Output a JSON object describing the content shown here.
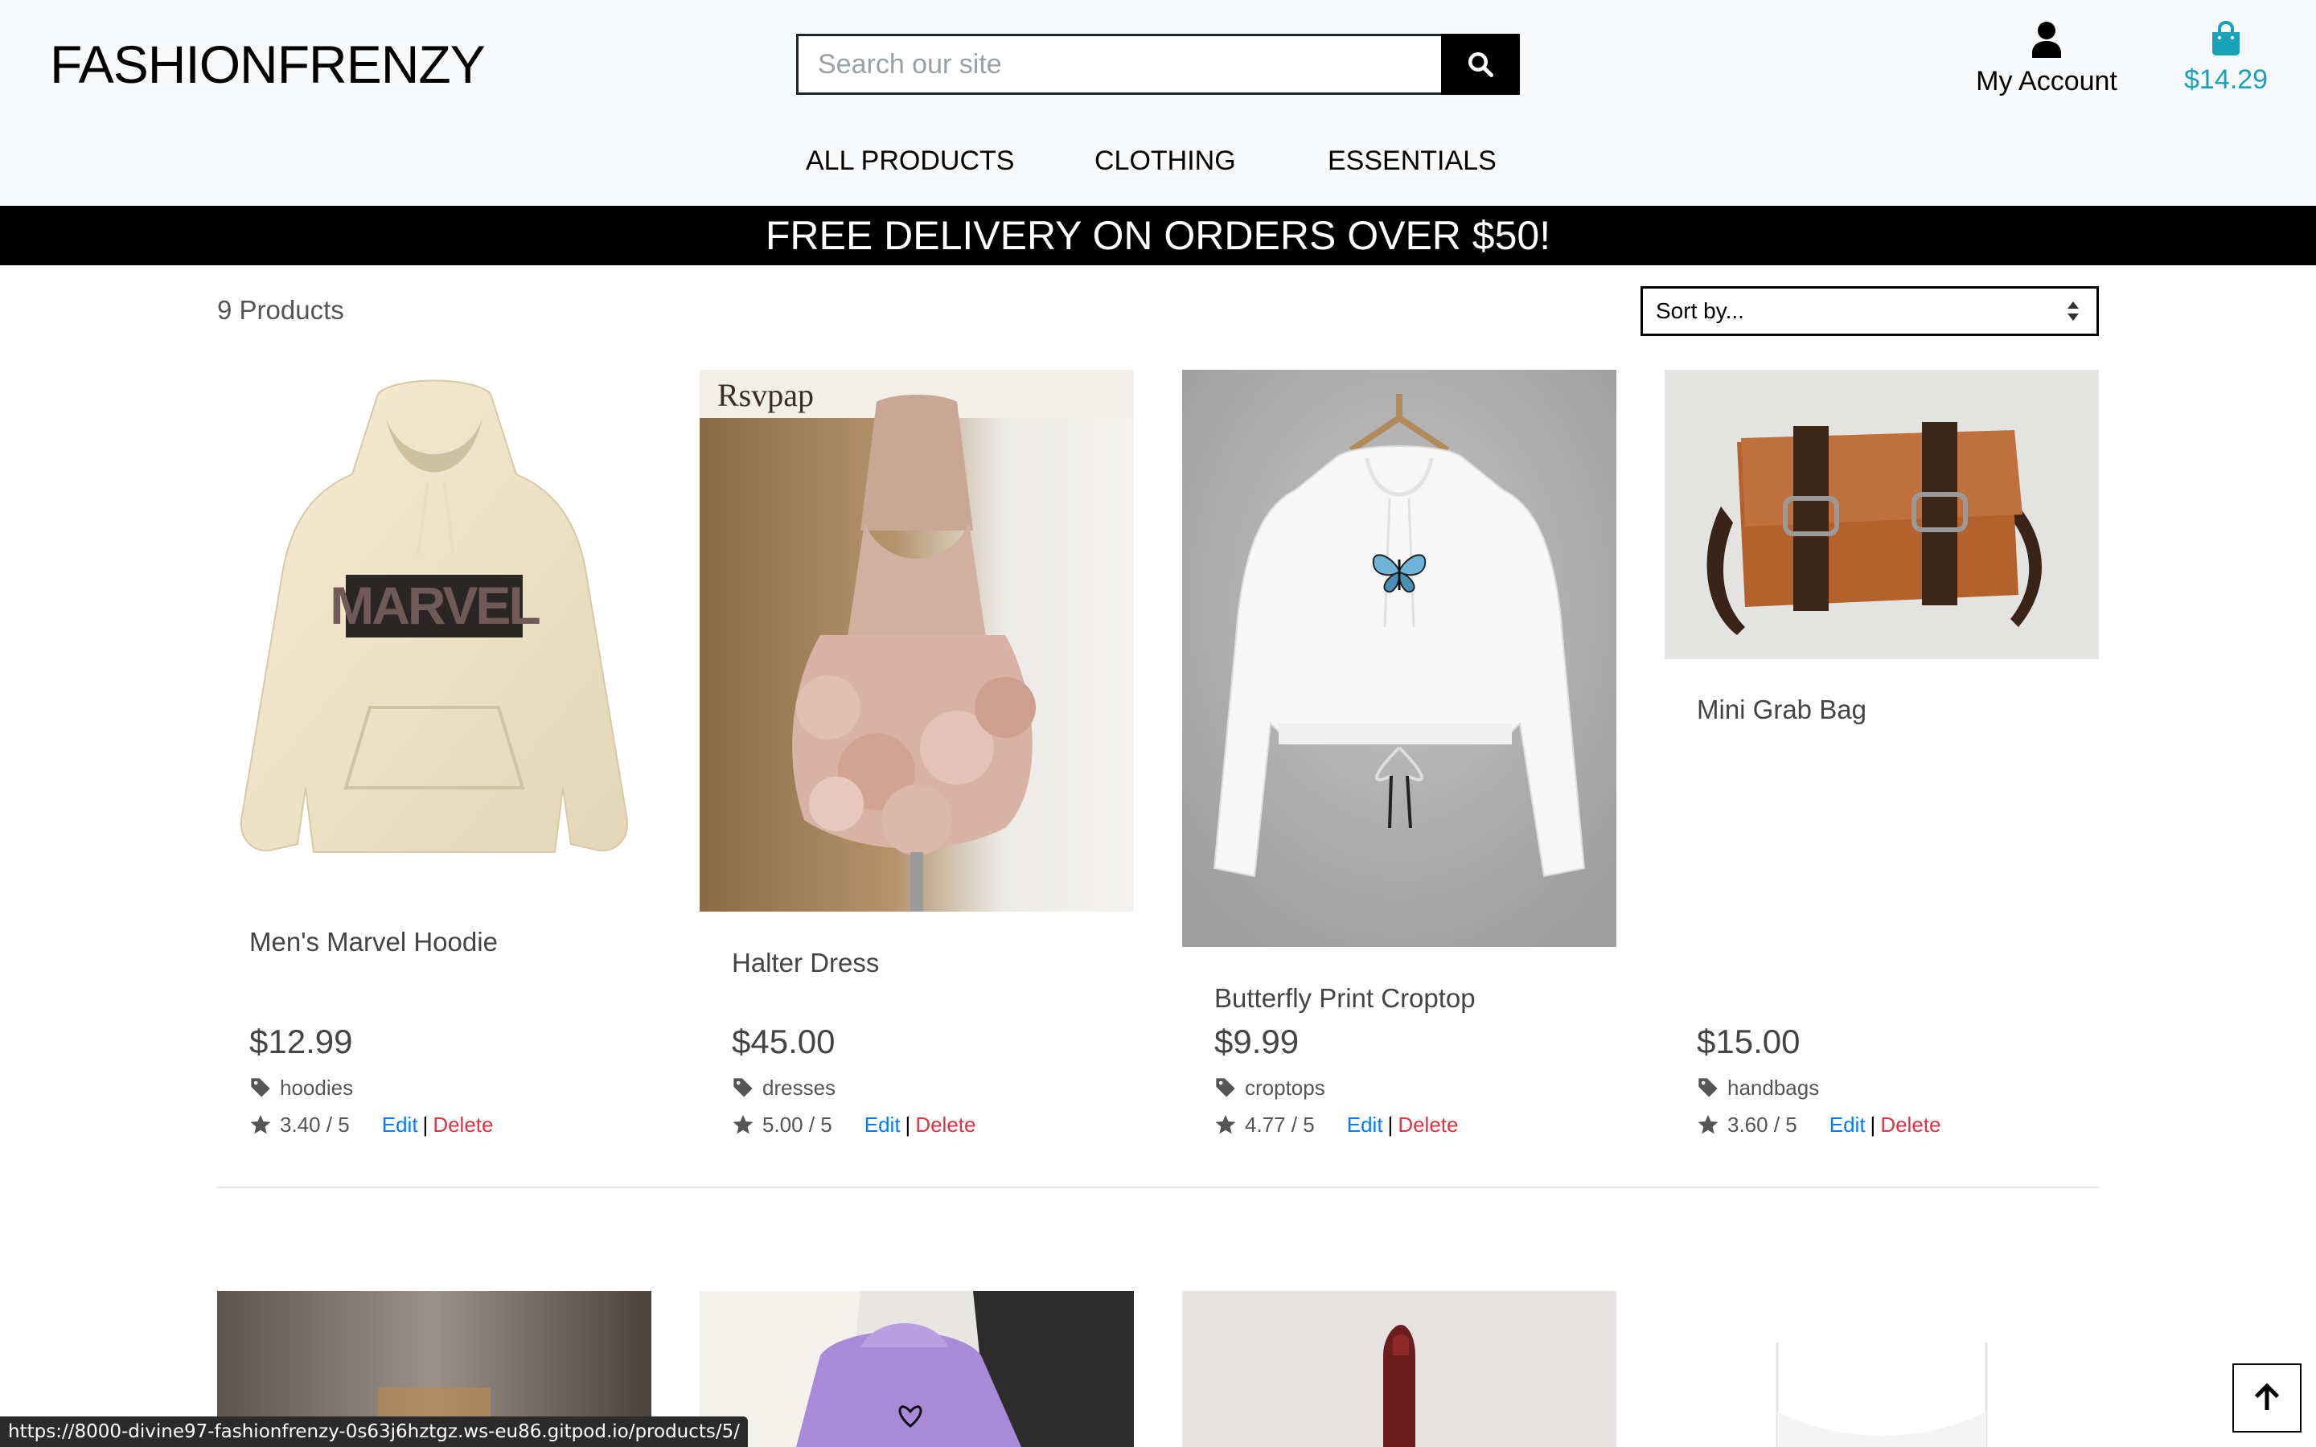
{
  "header": {
    "logo": "FASHIONFRENZY",
    "search_placeholder": "Search our site",
    "account_label": "My Account",
    "cart_total": "$14.29"
  },
  "nav": {
    "items": [
      "ALL PRODUCTS",
      "CLOTHING",
      "ESSENTIALS"
    ]
  },
  "banner": "FREE DELIVERY ON ORDERS OVER $50!",
  "toolbar": {
    "count": "9 Products",
    "sort_label": "Sort by..."
  },
  "products": [
    {
      "name": "Men's Marvel Hoodie",
      "price": "$12.99",
      "category": "hoodies",
      "rating": "3.40 / 5",
      "image": "cream marvel hoodie"
    },
    {
      "name": "Halter Dress",
      "price": "$45.00",
      "category": "dresses",
      "rating": "5.00 / 5",
      "image": "pink halter dress",
      "image_text": "Rsvpap"
    },
    {
      "name": "Butterfly Print Croptop",
      "price": "$9.99",
      "category": "croptops",
      "rating": "4.77 / 5",
      "image": "white butterfly croptop"
    },
    {
      "name": "Mini Grab Bag",
      "price": "$15.00",
      "category": "handbags",
      "rating": "3.60 / 5",
      "image": "brown leather bag"
    }
  ],
  "actions": {
    "edit": "Edit",
    "sep": "|",
    "delete": "Delete"
  },
  "status_url": "https://8000-divine97-fashionfrenzy-0s63j6hztgz.ws-eu86.gitpod.io/products/5/",
  "icons": {
    "search": "search-icon",
    "account": "user-icon",
    "cart": "shopping-bag-icon",
    "category": "tag-icon",
    "rating": "star-icon",
    "sort": "sort-arrows-icon",
    "scroll_top": "arrow-up-icon"
  },
  "colors": {
    "cart": "#17a2b8",
    "edit": "#007bff",
    "delete": "#dc3545",
    "banner": "#000000",
    "header_bg": "#f8f9fa"
  }
}
